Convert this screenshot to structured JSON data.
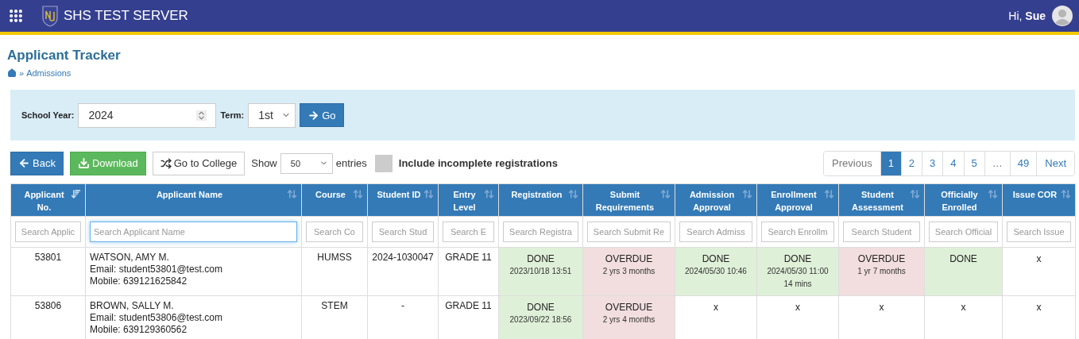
{
  "app_bar": {
    "title": "SHS TEST SERVER",
    "greeting": "Hi, **Sue**"
  },
  "page": {
    "title": "Applicant Tracker",
    "breadcrumb_separator": "»",
    "breadcrumb": "Admissions"
  },
  "filters": {
    "school_year_label": "School Year:",
    "school_year": "2024",
    "term_label": "Term:",
    "term": "1st",
    "go_button": "Go"
  },
  "toolbar": {
    "back_button": "Back",
    "download_button": "Download",
    "college_button": "Go to College",
    "show_label": "Show",
    "entries_value": "50",
    "entries_label": "entries",
    "incomplete": {
      "label": "Include incomplete registrations",
      "checked": false
    }
  },
  "pagination": [
    {
      "label": "Previous",
      "selected": false,
      "disabled": true
    },
    {
      "label": "1",
      "selected": true,
      "disabled": false
    },
    {
      "label": "2",
      "selected": false,
      "disabled": false
    },
    {
      "label": "3",
      "selected": false,
      "disabled": false
    },
    {
      "label": "4",
      "selected": false,
      "disabled": false
    },
    {
      "label": "5",
      "selected": false,
      "disabled": false
    },
    {
      "label": "…",
      "selected": false,
      "disabled": true
    },
    {
      "label": "49",
      "selected": false,
      "disabled": false
    },
    {
      "label": "Next",
      "selected": false,
      "disabled": false
    }
  ],
  "table": {
    "columns": [
      {
        "label": "Applicant No.",
        "sorted": true,
        "search_placeholder": "Search Applic",
        "focused": false
      },
      {
        "label": "Applicant Name",
        "sorted": false,
        "search_placeholder": "Search Applicant Name",
        "focused": true
      },
      {
        "label": "Course",
        "sorted": false,
        "search_placeholder": "Search Co",
        "focused": false
      },
      {
        "label": "Student ID",
        "sorted": false,
        "search_placeholder": "Search Stud",
        "focused": false
      },
      {
        "label": "Entry Level",
        "sorted": false,
        "search_placeholder": "Search E",
        "focused": false
      },
      {
        "label": "Registration",
        "sorted": false,
        "search_placeholder": "Search Registra",
        "focused": false
      },
      {
        "label": "Submit Requirements",
        "sorted": false,
        "search_placeholder": "Search Submit Re",
        "focused": false
      },
      {
        "label": "Admission Approval",
        "sorted": false,
        "search_placeholder": "Search Admiss",
        "focused": false
      },
      {
        "label": "Enrollment Approval",
        "sorted": false,
        "search_placeholder": "Search Enrollm",
        "focused": false
      },
      {
        "label": "Student Assessment",
        "sorted": false,
        "search_placeholder": "Search Student",
        "focused": false
      },
      {
        "label": "Officially Enrolled",
        "sorted": false,
        "search_placeholder": "Search Official",
        "focused": false
      },
      {
        "label": "Issue COR",
        "sorted": false,
        "search_placeholder": "Search Issue",
        "focused": false
      }
    ],
    "rows": [
      {
        "applicant_no": "53801",
        "name": "WATSON, AMY M.",
        "email": "Email: student53801@test.com",
        "mobile": "Mobile: 639121625842",
        "course": "HUMSS",
        "student_id": "2024-1030047",
        "entry_level": "GRADE 11",
        "stages": [
          {
            "kind": "done",
            "label": "DONE",
            "details": [
              "2023/10/18 13:51"
            ]
          },
          {
            "kind": "overdue",
            "label": "OVERDUE",
            "details": [
              "2 yrs 3 months"
            ]
          },
          {
            "kind": "done",
            "label": "DONE",
            "details": [
              "2024/05/30 10:46"
            ]
          },
          {
            "kind": "done",
            "label": "DONE",
            "details": [
              "2024/05/30 11:00",
              "14 mins"
            ]
          },
          {
            "kind": "overdue",
            "label": "OVERDUE",
            "details": [
              "1 yr 7 months"
            ]
          },
          {
            "kind": "done",
            "label": "DONE"
          },
          {
            "kind": "pending",
            "label": "x"
          }
        ]
      },
      {
        "applicant_no": "53806",
        "name": "BROWN, SALLY M.",
        "email": "Email: student53806@test.com",
        "mobile": "Mobile: 639129360562",
        "course": "STEM",
        "student_id": "-",
        "entry_level": "GRADE 11",
        "stages": [
          {
            "kind": "done",
            "label": "DONE",
            "details": [
              "2023/09/22 18:56"
            ]
          },
          {
            "kind": "overdue",
            "label": "OVERDUE",
            "details": [
              "2 yrs 4 months"
            ]
          },
          {
            "kind": "pending",
            "label": "x"
          },
          {
            "kind": "pending",
            "label": "x"
          },
          {
            "kind": "pending",
            "label": "x"
          },
          {
            "kind": "pending",
            "label": "x"
          },
          {
            "kind": "pending",
            "label": "x"
          }
        ]
      }
    ]
  }
}
